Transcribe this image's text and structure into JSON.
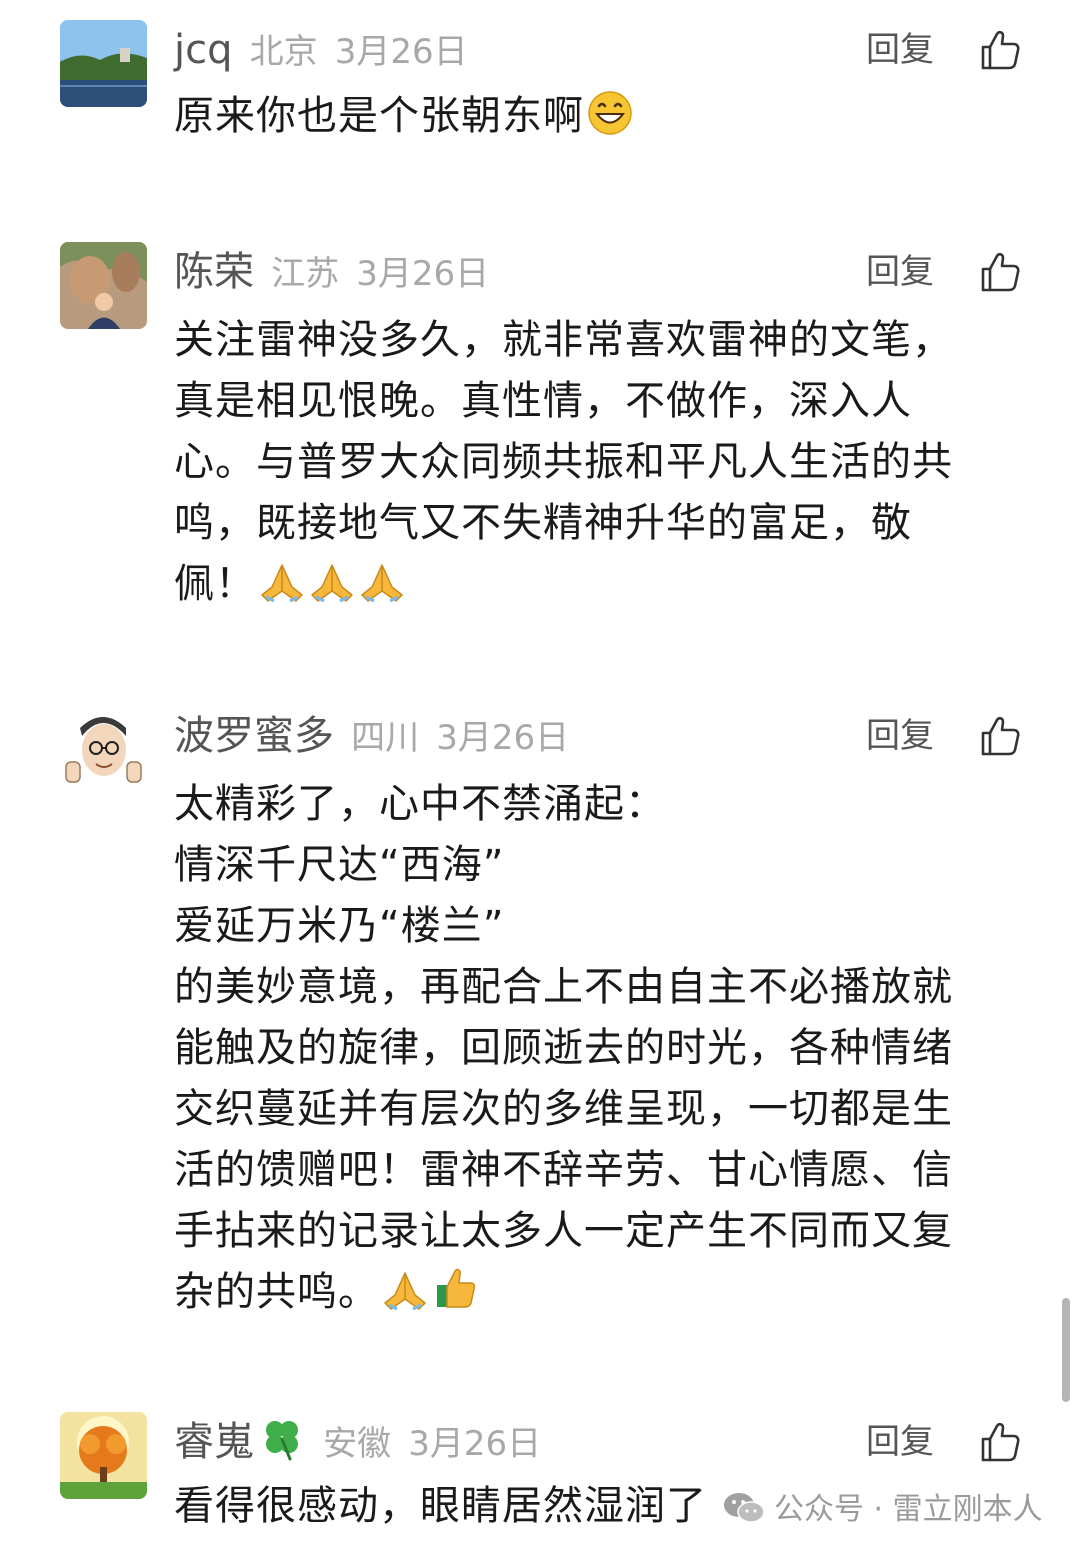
{
  "comments": [
    {
      "nickname": "jcq",
      "location": "北京",
      "date": "3月26日",
      "reply_label": "回复",
      "avatar_icon": "landscape-lake-avatar",
      "lines": [
        "原来你也是个张朝东啊"
      ],
      "emoji": [
        "grinning-face"
      ]
    },
    {
      "nickname": "陈荣",
      "location": "江苏",
      "date": "3月26日",
      "reply_label": "回复",
      "avatar_icon": "person-at-stone-buddha-avatar",
      "lines": [
        "关注雷神没多久，就非常喜欢雷神的文笔，",
        "真是相见恨晚。真性情，不做作，深入人",
        "心。与普罗大众同频共振和平凡人生活的共",
        "鸣，既接地气又不失精神升华的富足，敬",
        "佩！"
      ],
      "emoji": [
        "folded-hands",
        "folded-hands",
        "folded-hands"
      ]
    },
    {
      "nickname": "波罗蜜多",
      "location": "四川",
      "date": "3月26日",
      "reply_label": "回复",
      "avatar_icon": "cartoon-glasses-man-thumbs-up-avatar",
      "lines": [
        "太精彩了，心中不禁涌起：",
        "情深千尺达“西海”",
        "爱延万米乃“楼兰”",
        "的美妙意境，再配合上不由自主不必播放就",
        "能触及的旋律，回顾逝去的时光，各种情绪",
        "交织蔓延并有层次的多维呈现，一切都是生",
        "活的馈赠吧！雷神不辞辛劳、甘心情愿、信",
        "手拈来的记录让太多人一定产生不同而又复",
        "杂的共鸣。"
      ],
      "emoji": [
        "folded-hands",
        "thumbs-up"
      ]
    },
    {
      "nickname": "睿嵬",
      "location": "安徽",
      "date": "3月26日",
      "reply_label": "回复",
      "avatar_icon": "golden-tree-avatar",
      "nickname_emoji": "four-leaf-clover",
      "lines": [
        "看得很感动，眼睛居然湿润了"
      ],
      "emoji": []
    }
  ],
  "watermark": {
    "icon": "wechat-icon",
    "text": "公众号 · 雷立刚本人"
  },
  "colors": {
    "nickname": "#555555",
    "meta": "#a8a8a8",
    "body_text": "#1a1a1a",
    "scrollbar": "#b5b5b5"
  }
}
